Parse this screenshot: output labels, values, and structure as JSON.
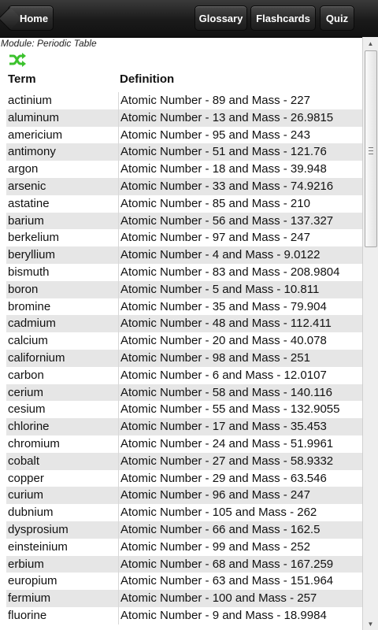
{
  "nav": {
    "home_label": "Home",
    "glossary_label": "Glossary",
    "flashcards_label": "Flashcards",
    "quiz_label": "Quiz"
  },
  "module_label": "Module: Periodic Table",
  "shuffle_icon": "shuffle-icon",
  "accent_color": "#3cc22e",
  "table": {
    "headers": [
      "Term",
      "Definition"
    ],
    "rows": [
      {
        "term": "actinium",
        "definition": "Atomic Number - 89 and Mass - 227"
      },
      {
        "term": "aluminum",
        "definition": "Atomic Number - 13 and Mass - 26.9815"
      },
      {
        "term": "americium",
        "definition": "Atomic Number - 95 and Mass - 243"
      },
      {
        "term": "antimony",
        "definition": "Atomic Number - 51 and Mass - 121.76"
      },
      {
        "term": "argon",
        "definition": "Atomic Number - 18 and Mass - 39.948"
      },
      {
        "term": "arsenic",
        "definition": "Atomic Number - 33 and Mass - 74.9216"
      },
      {
        "term": "astatine",
        "definition": "Atomic Number - 85 and Mass - 210"
      },
      {
        "term": "barium",
        "definition": "Atomic Number - 56 and Mass - 137.327"
      },
      {
        "term": "berkelium",
        "definition": "Atomic Number - 97 and Mass - 247"
      },
      {
        "term": "beryllium",
        "definition": "Atomic Number - 4 and Mass - 9.0122"
      },
      {
        "term": "bismuth",
        "definition": "Atomic Number - 83 and Mass - 208.9804"
      },
      {
        "term": "boron",
        "definition": "Atomic Number - 5 and Mass - 10.811"
      },
      {
        "term": "bromine",
        "definition": "Atomic Number - 35 and Mass - 79.904"
      },
      {
        "term": "cadmium",
        "definition": "Atomic Number - 48 and Mass - 112.411"
      },
      {
        "term": "calcium",
        "definition": "Atomic Number - 20 and Mass - 40.078"
      },
      {
        "term": "californium",
        "definition": "Atomic Number - 98 and Mass - 251"
      },
      {
        "term": "carbon",
        "definition": "Atomic Number - 6 and Mass - 12.0107"
      },
      {
        "term": "cerium",
        "definition": "Atomic Number - 58 and Mass - 140.116"
      },
      {
        "term": "cesium",
        "definition": "Atomic Number - 55 and Mass - 132.9055"
      },
      {
        "term": "chlorine",
        "definition": "Atomic Number - 17 and Mass - 35.453"
      },
      {
        "term": "chromium",
        "definition": "Atomic Number - 24 and Mass - 51.9961"
      },
      {
        "term": "cobalt",
        "definition": "Atomic Number - 27 and Mass - 58.9332"
      },
      {
        "term": "copper",
        "definition": "Atomic Number - 29 and Mass - 63.546"
      },
      {
        "term": "curium",
        "definition": "Atomic Number - 96 and Mass - 247"
      },
      {
        "term": "dubnium",
        "definition": "Atomic Number - 105 and Mass - 262"
      },
      {
        "term": "dysprosium",
        "definition": "Atomic Number - 66 and Mass - 162.5"
      },
      {
        "term": "einsteinium",
        "definition": "Atomic Number - 99 and Mass - 252"
      },
      {
        "term": "erbium",
        "definition": "Atomic Number - 68 and Mass - 167.259"
      },
      {
        "term": "europium",
        "definition": "Atomic Number - 63 and Mass - 151.964"
      },
      {
        "term": "fermium",
        "definition": "Atomic Number - 100 and Mass - 257"
      },
      {
        "term": "fluorine",
        "definition": "Atomic Number - 9 and Mass - 18.9984"
      }
    ]
  }
}
